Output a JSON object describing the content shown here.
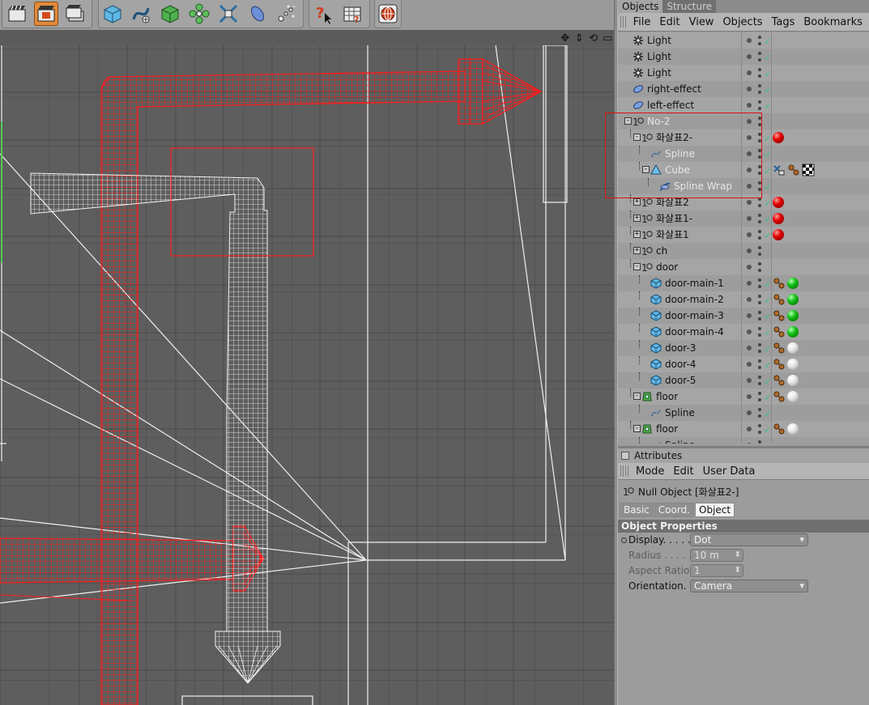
{
  "object_manager": {
    "tabs": [
      {
        "label": "Objects",
        "active": true
      },
      {
        "label": "Structure",
        "active": false
      }
    ],
    "menu": [
      "File",
      "Edit",
      "View",
      "Objects",
      "Tags",
      "Bookmarks"
    ],
    "rows": [
      {
        "name": "Light",
        "icon": "light-icon",
        "depth": 0,
        "expander": "",
        "dim": false,
        "tags": []
      },
      {
        "name": "Light",
        "icon": "light-icon",
        "depth": 0,
        "expander": "",
        "dim": false,
        "tags": []
      },
      {
        "name": "Light",
        "icon": "light-icon",
        "depth": 0,
        "expander": "",
        "dim": false,
        "tags": []
      },
      {
        "name": "right-effect",
        "icon": "effector-icon",
        "depth": 0,
        "expander": "",
        "dim": false,
        "tags": []
      },
      {
        "name": "left-effect",
        "icon": "effector-icon",
        "depth": 0,
        "expander": "",
        "dim": false,
        "tags": []
      },
      {
        "name": "No-2",
        "icon": "null-object-icon",
        "depth": 0,
        "expander": "−",
        "dim": true,
        "tags": []
      },
      {
        "name": "화살표2-",
        "icon": "null-object-icon",
        "depth": 1,
        "expander": "−",
        "dim": false,
        "tags": [
          "red-material-tag"
        ]
      },
      {
        "name": "Spline",
        "icon": "spline-icon",
        "depth": 2,
        "expander": "",
        "dim": true,
        "tags": []
      },
      {
        "name": "Cube",
        "icon": "cube-primitive-icon",
        "depth": 2,
        "expander": "−",
        "dim": true,
        "tags": [
          "display-tag",
          "phong-tag",
          "checker-material-tag"
        ]
      },
      {
        "name": "Spline Wrap",
        "icon": "spline-wrap-icon",
        "depth": 3,
        "expander": "",
        "dim": true,
        "tags": []
      },
      {
        "name": "화살표2",
        "icon": "null-object-icon",
        "depth": 1,
        "expander": "+",
        "dim": false,
        "tags": [
          "red-material-tag"
        ]
      },
      {
        "name": "화살표1-",
        "icon": "null-object-icon",
        "depth": 1,
        "expander": "+",
        "dim": false,
        "tags": [
          "red-material-tag"
        ]
      },
      {
        "name": "화살표1",
        "icon": "null-object-icon",
        "depth": 1,
        "expander": "+",
        "dim": false,
        "tags": [
          "red-material-tag"
        ]
      },
      {
        "name": "ch",
        "icon": "null-object-icon",
        "depth": 1,
        "expander": "+",
        "dim": false,
        "tags": []
      },
      {
        "name": "door",
        "icon": "null-object-icon",
        "depth": 1,
        "expander": "−",
        "dim": false,
        "tags": []
      },
      {
        "name": "door-main-1",
        "icon": "polygon-object-icon",
        "depth": 2,
        "expander": "",
        "dim": false,
        "tags": [
          "phong-tag",
          "green-material-tag"
        ]
      },
      {
        "name": "door-main-2",
        "icon": "polygon-object-icon",
        "depth": 2,
        "expander": "",
        "dim": false,
        "tags": [
          "phong-tag",
          "green-material-tag"
        ]
      },
      {
        "name": "door-main-3",
        "icon": "polygon-object-icon",
        "depth": 2,
        "expander": "",
        "dim": false,
        "tags": [
          "phong-tag",
          "green-material-tag"
        ]
      },
      {
        "name": "door-main-4",
        "icon": "polygon-object-icon",
        "depth": 2,
        "expander": "",
        "dim": false,
        "tags": [
          "phong-tag",
          "green-material-tag"
        ]
      },
      {
        "name": "door-3",
        "icon": "polygon-object-icon",
        "depth": 2,
        "expander": "",
        "dim": false,
        "tags": [
          "phong-tag",
          "white-material-tag"
        ]
      },
      {
        "name": "door-4",
        "icon": "polygon-object-icon",
        "depth": 2,
        "expander": "",
        "dim": false,
        "tags": [
          "phong-tag",
          "white-material-tag"
        ]
      },
      {
        "name": "door-5",
        "icon": "polygon-object-icon",
        "depth": 2,
        "expander": "",
        "dim": false,
        "tags": [
          "phong-tag",
          "white-material-tag"
        ]
      },
      {
        "name": "floor",
        "icon": "extrude-nurbs-icon",
        "depth": 1,
        "expander": "−",
        "dim": false,
        "tags": [
          "phong-tag",
          "white-material-tag"
        ]
      },
      {
        "name": "Spline",
        "icon": "spline-icon",
        "depth": 2,
        "expander": "",
        "dim": false,
        "tags": []
      },
      {
        "name": "floor",
        "icon": "extrude-nurbs-icon",
        "depth": 1,
        "expander": "−",
        "dim": false,
        "tags": [
          "phong-tag",
          "white-material-tag"
        ]
      },
      {
        "name": "Spline",
        "icon": "spline-icon",
        "depth": 2,
        "expander": "",
        "dim": false,
        "tags": []
      }
    ]
  },
  "attributes": {
    "header": "Attributes",
    "menu": [
      "Mode",
      "Edit",
      "User Data"
    ],
    "title": "Null Object [화살표2-]",
    "tabs": [
      {
        "label": "Basic",
        "active": false
      },
      {
        "label": "Coord.",
        "active": false
      },
      {
        "label": "Object",
        "active": true
      }
    ],
    "section": "Object Properties",
    "props": [
      {
        "label": "Display. . . . .",
        "value": "Dot",
        "kind": "dropdown",
        "dim": false,
        "radio": true
      },
      {
        "label": "Radius . . . . .",
        "value": "10 m",
        "kind": "number",
        "dim": true,
        "radio": false
      },
      {
        "label": "Aspect Ratio",
        "value": "1",
        "kind": "number",
        "dim": true,
        "radio": false
      },
      {
        "label": "Orientation. .",
        "value": "Camera",
        "kind": "dropdown",
        "dim": false,
        "radio": false
      }
    ]
  },
  "toolbar": {
    "buttons": [
      "render-view-icon",
      "render-active-icon",
      "render-settings-icon",
      "cube-primitive-icon",
      "spline-tool-icon",
      "nurbs-icon",
      "array-icon",
      "deformer-icon",
      "scene-icon",
      "particle-icon",
      "help-icon",
      "timeline-icon",
      "cinema-icon"
    ]
  },
  "viewport_nav": [
    "move-view-icon",
    "zoom-view-icon",
    "rotate-view-icon",
    "maximize-view-icon"
  ],
  "colors": {
    "wire_red": "#ff1a1a",
    "wire_white": "#f4f4f4",
    "grid": "#4e4e4e",
    "selection_box": "#e01010"
  }
}
